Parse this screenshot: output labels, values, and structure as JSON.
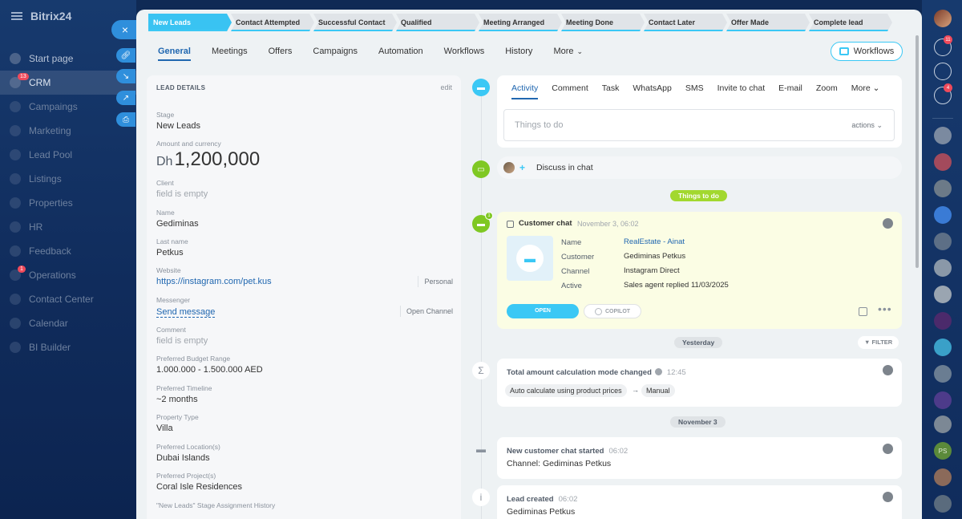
{
  "sidebar": {
    "brand": "Bitrix24",
    "crm_badge": "13",
    "ops_badge": "1",
    "items": [
      {
        "label": "Start page",
        "dim": false
      },
      {
        "label": "CRM",
        "dim": false,
        "active": true
      },
      {
        "label": "Campaings",
        "dim": true
      },
      {
        "label": "Marketing",
        "dim": true
      },
      {
        "label": "Lead Pool",
        "dim": true
      },
      {
        "label": "Listings",
        "dim": true
      },
      {
        "label": "Properties",
        "dim": true
      },
      {
        "label": "HR",
        "dim": true
      },
      {
        "label": "Feedback",
        "dim": true
      },
      {
        "label": "Operations",
        "dim": true
      },
      {
        "label": "Contact Center",
        "dim": true
      },
      {
        "label": "Calendar",
        "dim": true
      },
      {
        "label": "BI Builder",
        "dim": true
      }
    ],
    "close_glyph": "×"
  },
  "stages": [
    {
      "label": "New Leads",
      "current": true
    },
    {
      "label": "Contact Attempted"
    },
    {
      "label": "Successful Contact"
    },
    {
      "label": "Qualified"
    },
    {
      "label": "Meeting Arranged"
    },
    {
      "label": "Meeting Done"
    },
    {
      "label": "Contact Later"
    },
    {
      "label": "Offer Made"
    },
    {
      "label": "Complete lead"
    }
  ],
  "tabs": [
    "General",
    "Meetings",
    "Offers",
    "Campaigns",
    "Automation",
    "Workflows",
    "History",
    "More"
  ],
  "workflows_button": "Workflows",
  "details": {
    "title": "LEAD DETAILS",
    "edit": "edit",
    "stage_label": "Stage",
    "stage_value": "New Leads",
    "amount_label": "Amount and currency",
    "amount_currency": "Dh",
    "amount_value": "1,200,000",
    "client_label": "Client",
    "client_value": "field is empty",
    "name_label": "Name",
    "name_value": "Gediminas",
    "lastname_label": "Last name",
    "lastname_value": "Petkus",
    "website_label": "Website",
    "website_value": "https://instagram.com/pet.kus",
    "website_type": "Personal",
    "messenger_label": "Messenger",
    "messenger_value": "Send message",
    "messenger_action": "Open Channel",
    "comment_label": "Comment",
    "comment_value": "field is empty",
    "budget_label": "Preferred Budget Range",
    "budget_value": "1.000.000 - 1.500.000 AED",
    "timeline_label": "Preferred Timeline",
    "timeline_value": "~2 months",
    "ptype_label": "Property Type",
    "ptype_value": "Villa",
    "location_label": "Preferred Location(s)",
    "location_value": "Dubai Islands",
    "project_label": "Preferred Project(s)",
    "project_value": "Coral Isle Residences",
    "history_label": "\"New Leads\" Stage Assignment History"
  },
  "activity": {
    "tabs": [
      "Activity",
      "Comment",
      "Task",
      "WhatsApp",
      "SMS",
      "Invite to chat",
      "E-mail",
      "Zoom",
      "More"
    ],
    "placeholder": "Things to do",
    "actions": "actions"
  },
  "discuss": "Discuss in chat",
  "things_to_do": "Things to do",
  "chat_card": {
    "badge": "1",
    "title": "Customer chat",
    "date": "November 3, 06:02",
    "rows": [
      {
        "label": "Name",
        "value": "RealEstate - Ainat",
        "link": true
      },
      {
        "label": "Customer",
        "value": "Gediminas Petkus"
      },
      {
        "label": "Channel",
        "value": "Instagram Direct"
      },
      {
        "label": "Active",
        "value": "Sales agent replied 11/03/2025"
      }
    ],
    "open": "OPEN",
    "copilot": "COPILOT"
  },
  "yesterday": "Yesterday",
  "filter": "FILTER",
  "calc_event": {
    "title": "Total amount calculation mode changed",
    "time": "12:45",
    "from": "Auto calculate using product prices",
    "arrow": "→",
    "to": "Manual"
  },
  "november3": "November 3",
  "chat_started": {
    "title": "New customer chat started",
    "time": "06:02",
    "body": "Channel: Gediminas Petkus"
  },
  "lead_created": {
    "title": "Lead created",
    "time": "06:02",
    "body": "Gediminas Petkus"
  },
  "right_sidebar": {
    "notif_badge": "11",
    "chat_badge": "4",
    "ps_initials": "PS"
  },
  "colors": {
    "accent": "#3bc8f5",
    "green": "#7fc823",
    "link": "#2067b0"
  }
}
